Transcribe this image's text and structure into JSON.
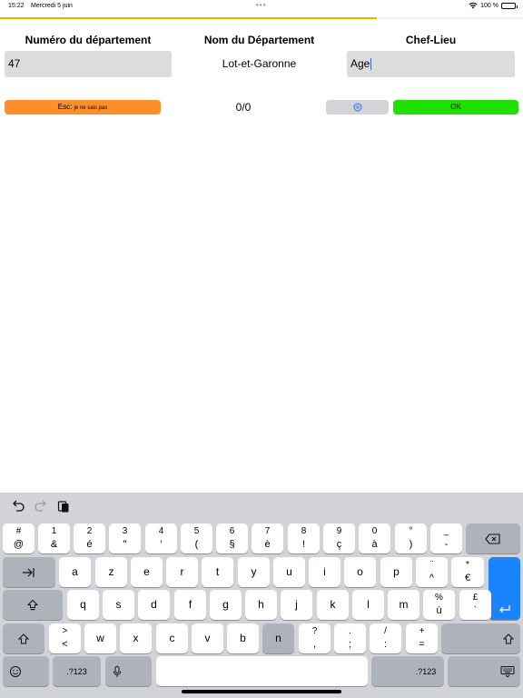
{
  "status_bar": {
    "time": "15:22",
    "date": "Mercredi 5 juin",
    "dots": "•••",
    "battery": "100 %",
    "icons": [
      "wifi-icon",
      "battery-icon"
    ]
  },
  "progress": {
    "fraction": 0.72,
    "color": "#f0b400"
  },
  "columns": {
    "numero": {
      "header": "Numéro du département",
      "value": "47"
    },
    "nom": {
      "header": "Nom du Département",
      "value": "Lot-et-Garonne"
    },
    "chef": {
      "header": "Chef-Lieu",
      "value": "Age"
    }
  },
  "actions": {
    "esc_key": "Esc:",
    "esc_text": "je ne sais pas",
    "counter": "0/0",
    "pause_icon": "pause-circle-icon",
    "ok": "OK"
  },
  "colors": {
    "esc": "#ff8e2b",
    "ok": "#1fe000",
    "pause": "#d4d4d8",
    "field": "#dcdcdc",
    "keyboard": "#d1d3d9",
    "return": "#1a84ff"
  },
  "keyboard": {
    "toolbar": [
      "undo-icon",
      "redo-icon",
      "paste-icon"
    ],
    "row1": [
      {
        "top": "#",
        "bot": "@"
      },
      {
        "top": "1",
        "bot": "&"
      },
      {
        "top": "2",
        "bot": "é"
      },
      {
        "top": "3",
        "bot": "\""
      },
      {
        "top": "4",
        "bot": "'"
      },
      {
        "top": "5",
        "bot": "("
      },
      {
        "top": "6",
        "bot": "§"
      },
      {
        "top": "7",
        "bot": "è"
      },
      {
        "top": "8",
        "bot": "!"
      },
      {
        "top": "9",
        "bot": "ç"
      },
      {
        "top": "0",
        "bot": "à"
      },
      {
        "top": "°",
        "bot": ")"
      },
      {
        "top": "_",
        "bot": "-"
      }
    ],
    "row2": [
      "a",
      "z",
      "e",
      "r",
      "t",
      "y",
      "u",
      "i",
      "o",
      "p"
    ],
    "row2_extra": [
      {
        "top": "¨",
        "bot": "^"
      },
      {
        "top": "*",
        "bot": "€"
      }
    ],
    "row3": [
      "q",
      "s",
      "d",
      "f",
      "g",
      "h",
      "j",
      "k",
      "l",
      "m"
    ],
    "row3_extra": [
      {
        "top": "%",
        "bot": "ù"
      },
      {
        "top": "£",
        "bot": "`"
      }
    ],
    "row4_sym": [
      {
        "top": ">",
        "bot": "<"
      }
    ],
    "row4": [
      "w",
      "x",
      "c",
      "v",
      "b",
      "n"
    ],
    "row4_punct": [
      {
        "top": "?",
        "bot": ","
      },
      {
        "top": ".",
        "bot": ";"
      },
      {
        "top": "/",
        "bot": ":"
      },
      {
        "top": "+",
        "bot": "="
      }
    ],
    "numbers_key": ".?123"
  }
}
